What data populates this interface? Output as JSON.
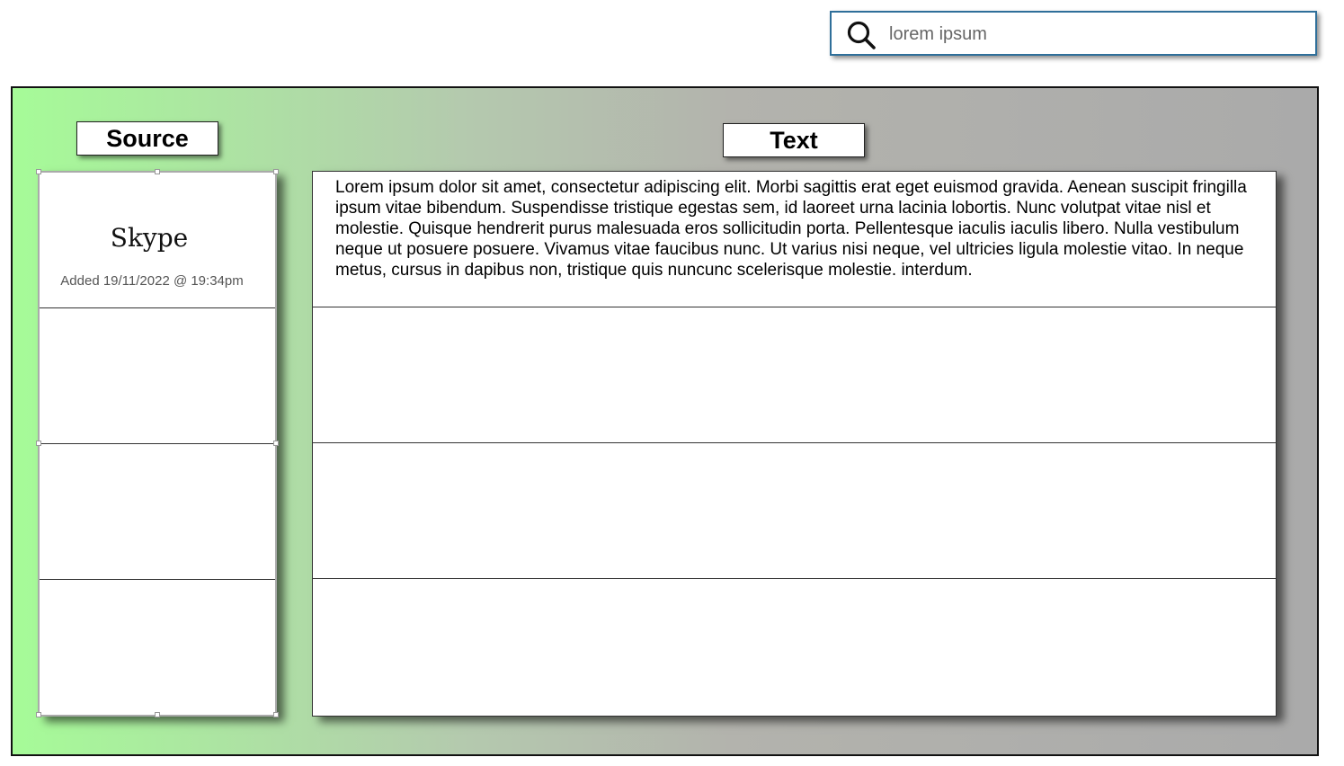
{
  "search": {
    "placeholder": "lorem ipsum",
    "icon": "search-icon"
  },
  "headers": {
    "source_label": "Source",
    "text_label": "Text"
  },
  "sources": [
    {
      "name": "Skype",
      "added": "Added 19/11/2022 @ 19:34pm"
    },
    {
      "name": "",
      "added": ""
    },
    {
      "name": "",
      "added": ""
    },
    {
      "name": "",
      "added": ""
    }
  ],
  "texts": [
    {
      "body": "Lorem ipsum dolor sit amet, consectetur adipiscing elit. Morbi sagittis erat eget euismod gravida. Aenean suscipit fringilla ipsum vitae bibendum. Suspendisse tristique egestas sem, id laoreet urna lacinia lobortis. Nunc volutpat vitae nisl et molestie. Quisque hendrerit purus malesuada eros sollicitudin porta. Pellentesque iaculis iaculis libero. Nulla vestibulum neque ut posuere posuere. Vivamus vitae faucibus nunc. Ut varius nisi neque, vel ultricies ligula molestie vitao. In neque metus, cursus in dapibus non, tristique quis nuncunc scelerisque molestie. interdum."
    },
    {
      "body": ""
    },
    {
      "body": ""
    },
    {
      "body": ""
    }
  ],
  "colors": {
    "gradient_start": "#a6fb98",
    "gradient_end": "#aaaaaa",
    "search_border": "#2f6f9a"
  }
}
